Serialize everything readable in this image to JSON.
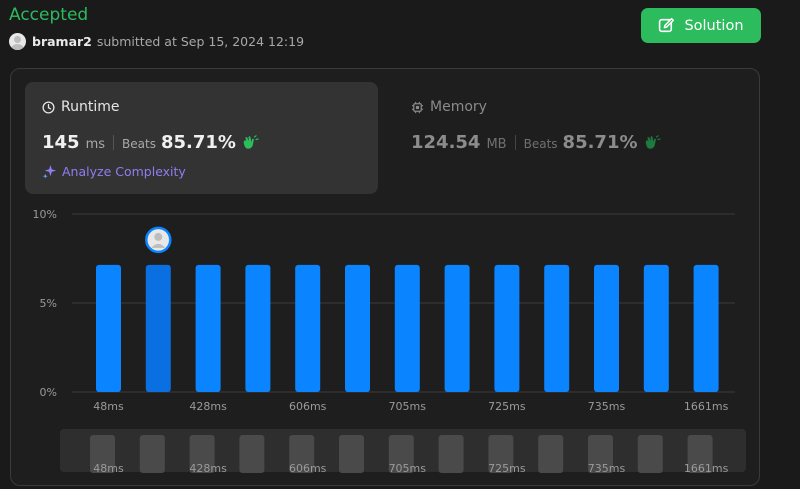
{
  "header": {
    "status": "Accepted",
    "username": "bramar2",
    "submitted_text": "submitted at Sep 15, 2024 12:19",
    "solution_button": "Solution"
  },
  "runtime": {
    "title": "Runtime",
    "value": "145",
    "unit": "ms",
    "beats_label": "Beats",
    "beats_value": "85.71%",
    "analyze_label": "Analyze Complexity"
  },
  "memory": {
    "title": "Memory",
    "value": "124.54",
    "unit": "MB",
    "beats_label": "Beats",
    "beats_value": "85.71%"
  },
  "colors": {
    "accepted": "#2cbb5d",
    "bar": "#0a84ff",
    "bar_highlight": "#0a6fe0",
    "analyze": "#8f7df2"
  },
  "chart_data": {
    "type": "bar",
    "categories": [
      "48ms",
      "",
      "428ms",
      "",
      "606ms",
      "",
      "705ms",
      "",
      "725ms",
      "",
      "735ms",
      "",
      "1661ms"
    ],
    "values": [
      7.14,
      7.14,
      7.14,
      7.14,
      7.14,
      7.14,
      7.14,
      7.14,
      7.14,
      7.14,
      7.14,
      7.14,
      7.14
    ],
    "highlight_index": 1,
    "yticks": [
      "0%",
      "5%",
      "10%"
    ],
    "ylim": [
      0,
      10
    ],
    "grid": true
  }
}
